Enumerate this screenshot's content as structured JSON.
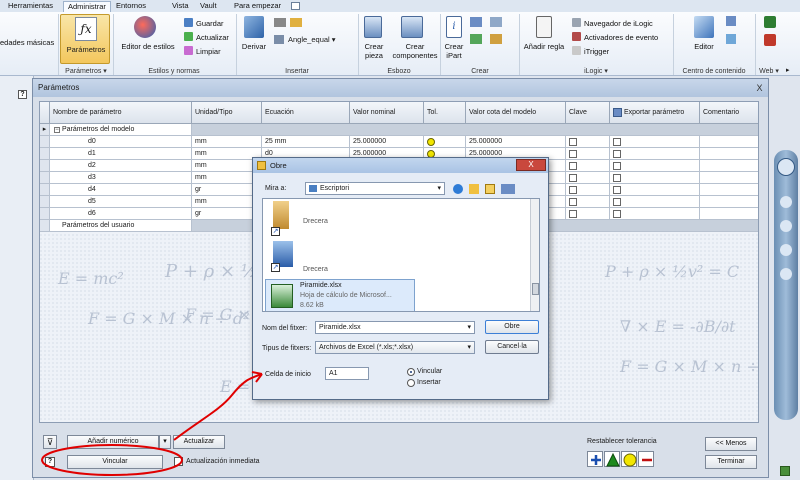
{
  "colors": {
    "accent": "#2a5ca8",
    "red_annotation": "#e00000",
    "tolerance_yellow": "#f2e600"
  },
  "ribbon": {
    "tabs": [
      {
        "label": "Herramientas"
      },
      {
        "label": "Administrar"
      },
      {
        "label": "Entornos"
      },
      {
        "label": "Vista"
      },
      {
        "label": "Vault"
      },
      {
        "label": "Para empezar"
      }
    ],
    "left_cut_label": "edades másicas",
    "parametros_button": "Parámetros",
    "editor_estilos": "Editor de estilos",
    "guardar": "Guardar",
    "actualizar": "Actualizar",
    "limpiar": "Limpiar",
    "derivar": "Derivar",
    "angle_equal": "Angle_equal",
    "crear_pieza": "Crear pieza",
    "crear_componentes": "Crear componentes",
    "crear_ipart": "Crear iPart",
    "anadir_regla": "Añadir regla",
    "navegador_ilogic": "Navegador de iLogic",
    "activadores_evento": "Activadores de evento",
    "itrigger": "iTrigger",
    "editor": "Editor",
    "groups": {
      "parametros": "Parámetros",
      "estilos": "Estilos y normas",
      "insertar": "Insertar",
      "esbozo": "Esbozo",
      "crear": "Crear",
      "ilogic": "iLogic",
      "centro": "Centro de contenido",
      "web": "Web"
    }
  },
  "dialog": {
    "title": "Parámetros",
    "close": "X",
    "columns": [
      "Nombre de parámetro",
      "Unidad/Tipo",
      "Ecuación",
      "Valor nominal",
      "Tol.",
      "Valor cota del modelo",
      "Clave",
      "Exportar parámetro",
      "Comentario"
    ],
    "model_group": "Parámetros del modelo",
    "user_group": "Parámetros del usuario",
    "rows": [
      {
        "name": "d0",
        "unit": "mm",
        "eq": "25 mm",
        "nominal": "25.000000",
        "model": "25.000000"
      },
      {
        "name": "d1",
        "unit": "mm",
        "eq": "d0",
        "nominal": "25.000000",
        "model": "25.000000"
      },
      {
        "name": "d2",
        "unit": "mm",
        "eq": "",
        "nominal": "",
        "model": ""
      },
      {
        "name": "d3",
        "unit": "mm",
        "eq": "",
        "nominal": "",
        "model": ""
      },
      {
        "name": "d4",
        "unit": "gr",
        "eq": "",
        "nominal": "",
        "model": ""
      },
      {
        "name": "d5",
        "unit": "mm",
        "eq": "",
        "nominal": "",
        "model": ""
      },
      {
        "name": "d6",
        "unit": "gr",
        "eq": "",
        "nominal": "",
        "model": ""
      }
    ],
    "watermark_formulas": [
      "E = mc²",
      "P + ρ × ½v² = C",
      "F = G × M × n ÷ d²",
      "∇ × E = -∂B/∂t"
    ],
    "add_numeric": "Añadir numérico",
    "update_button": "Actualizar",
    "link_button": "Vincular",
    "immediate_update": "Actualización inmediata",
    "reset_tolerance": "Restablecer tolerancia",
    "less_button": "<< Menos",
    "finish_button": "Terminar"
  },
  "file_dialog": {
    "title": "Obre",
    "close": "X",
    "look_in_label": "Mira a:",
    "look_in_value": "Escriptori",
    "items": [
      {
        "name": "Drecera",
        "type": "",
        "size": ""
      },
      {
        "name": "Drecera",
        "type": "",
        "size": ""
      },
      {
        "name": "Piramide.xlsx",
        "type": "Hoja de cálculo de Microsof...",
        "size": "8.62 kB"
      }
    ],
    "filename_label": "Nom del fitxer:",
    "filename_value": "Piramide.xlsx",
    "filetype_label": "Tipus de fitxers:",
    "filetype_value": "Archivos de Excel (*.xls;*.xlsx)",
    "open_button": "Obre",
    "cancel_button": "Cancel·la",
    "start_cell_label": "Celda de inicio",
    "start_cell_value": "A1",
    "option_link": "Vincular",
    "option_insert": "Insertar"
  }
}
